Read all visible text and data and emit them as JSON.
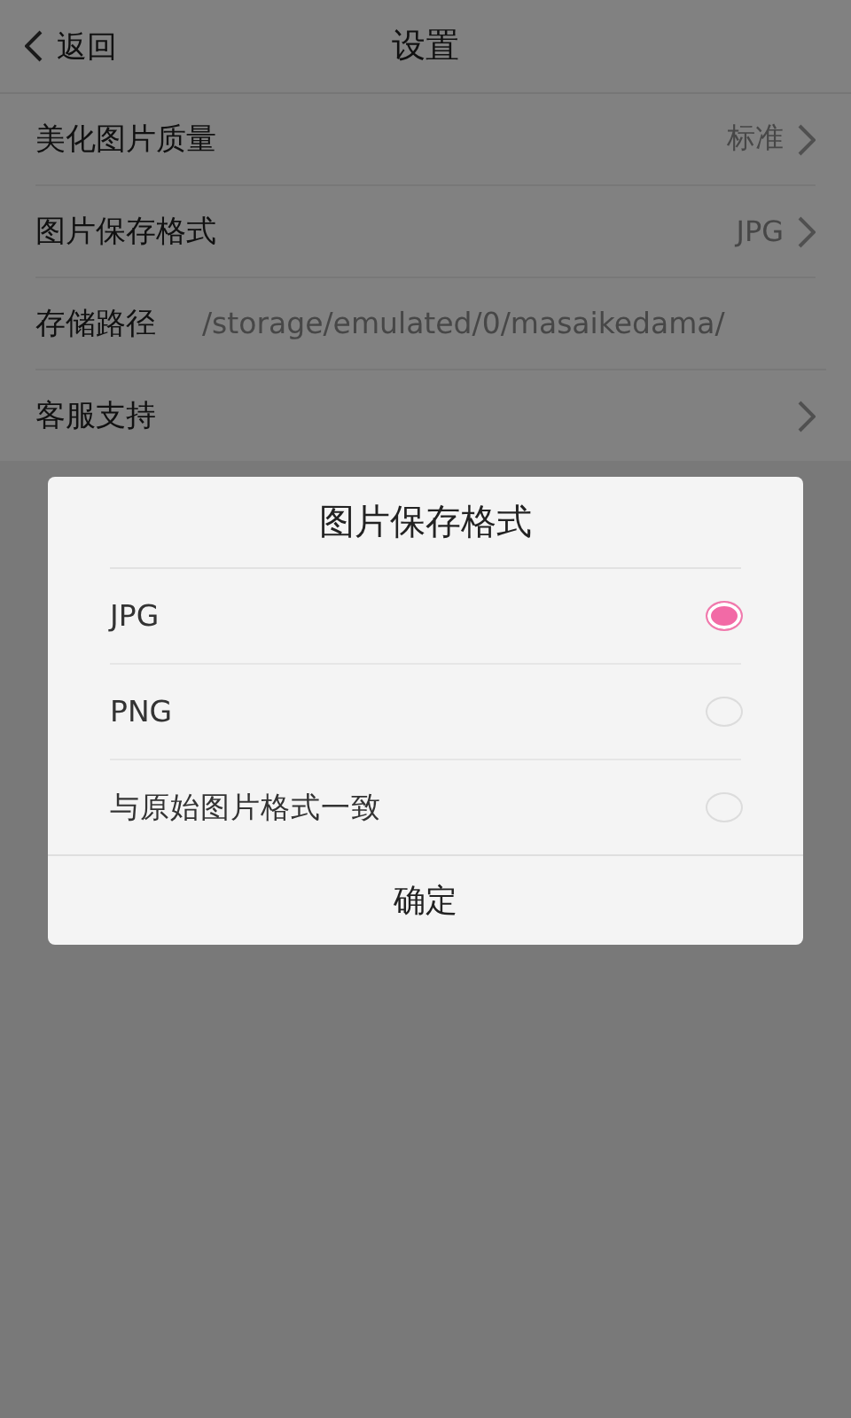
{
  "header": {
    "back_label": "返回",
    "title": "设置"
  },
  "settings": [
    {
      "kind": "link",
      "label": "美化图片质量",
      "value": "标准"
    },
    {
      "kind": "link",
      "label": "图片保存格式",
      "value": "JPG"
    },
    {
      "kind": "path",
      "label": "存储路径",
      "value": "/storage/emulated/0/masaikedama/"
    },
    {
      "kind": "link",
      "label": "客服支持"
    }
  ],
  "dialog": {
    "title": "图片保存格式",
    "options": [
      {
        "label": "JPG",
        "selected": true
      },
      {
        "label": "PNG",
        "selected": false
      },
      {
        "label": "与原始图片格式一致",
        "selected": false
      }
    ],
    "confirm": "确定"
  }
}
